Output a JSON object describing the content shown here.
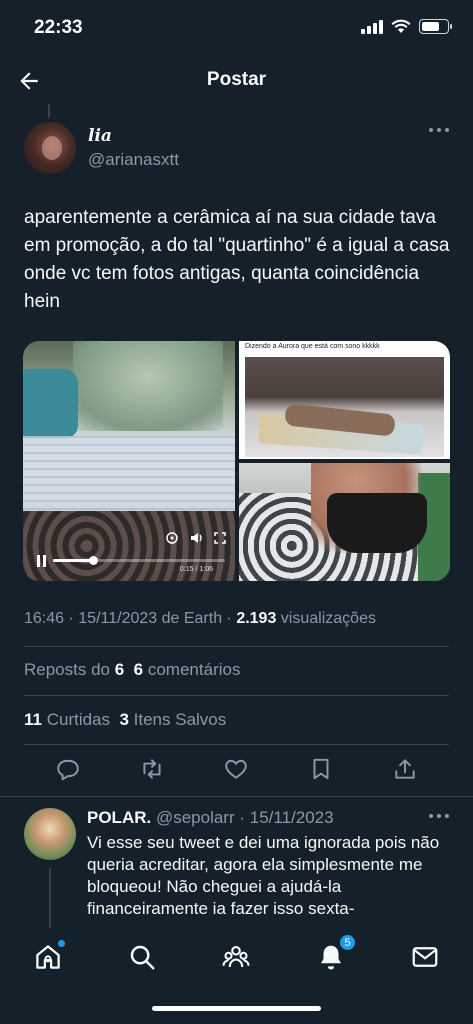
{
  "status_bar": {
    "time": "22:33"
  },
  "header": {
    "title": "Postar"
  },
  "tweet": {
    "author_name": "lia",
    "author_handle": "@arianasxtt",
    "text": "aparentemente a cerâmica aí na sua cidade tava em promoção, a do tal \"quartinho\" é a igual a casa onde vc tem fotos antigas, quanta coincidência hein",
    "media": {
      "video_time": "0:15 / 1:06",
      "video_progress": 0.23,
      "photo_caption": "Dizendo a Aurora que está com sono kkkkk"
    },
    "meta": {
      "time": "16:46",
      "sep1": " · ",
      "date": "15/11/2023",
      "source": " de Earth",
      "sep2": " · ",
      "views_count": "2.193",
      "views_label": " visualizações"
    },
    "stats": {
      "reposts_label": "Reposts do ",
      "reposts_count": "6",
      "comments_count": "6",
      "comments_label": " comentários",
      "likes_count": "11",
      "likes_label": " Curtidas",
      "saves_count": "3",
      "saves_label": " Itens Salvos"
    }
  },
  "reply": {
    "name": "POLAR.",
    "handle": " @sepolarr",
    "date": " · 15/11/2023",
    "text": "Vi esse seu tweet e dei uma ignorada pois não queria acreditar, agora ela simplesmente me bloqueou! Não cheguei a ajudá-la financeiramente ia fazer isso sexta-"
  },
  "tabbar": {
    "notifications_badge": "5"
  },
  "colors": {
    "background": "#15202b",
    "accent": "#1d9bf0",
    "secondary_text": "#8b98a5",
    "divider": "#38444d"
  }
}
